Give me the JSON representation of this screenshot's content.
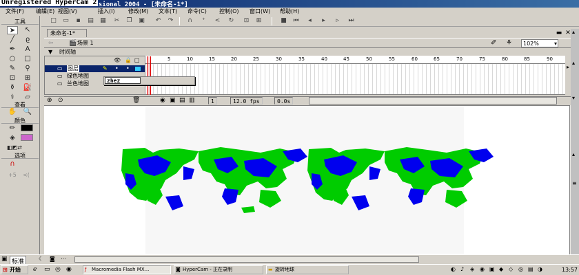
{
  "window": {
    "title": "Macromedia Flash MX Professional 2004 - [未命名-1*]",
    "recorder_watermark": "Unregistered HyperCam 2"
  },
  "menu": {
    "items": [
      "文件(F)",
      "编辑(E)",
      "视图(V)",
      "插入(I)",
      "修改(M)",
      "文本(T)",
      "命令(C)",
      "控制(O)",
      "窗口(W)",
      "帮助(H)"
    ]
  },
  "tools": {
    "heading": "工具",
    "view_heading": "查看",
    "colors_heading": "颜色",
    "options_heading": "选项"
  },
  "document": {
    "tab_label": "未命名-1*",
    "scene_label": "场景 1",
    "zoom_value": "102%",
    "timeline_heading": "时间轴"
  },
  "timeline": {
    "ruler_numbers": [
      "5",
      "10",
      "15",
      "20",
      "25",
      "30",
      "35",
      "40",
      "45",
      "50",
      "55",
      "60",
      "65",
      "70",
      "75",
      "80",
      "85",
      "90"
    ],
    "layers": [
      {
        "name": "图层",
        "active": true
      },
      {
        "name": "绿色地图",
        "active": false
      },
      {
        "name": "兰色地图",
        "active": false
      }
    ],
    "rename_input_value": "zhez",
    "current_frame": "1",
    "frame_rate": "12.0 fps",
    "elapsed_time": "0.0s"
  },
  "bottom_panel": {
    "label": "标准"
  },
  "taskbar": {
    "start_label": "开始",
    "tasks": [
      "Macromedia Flash MX...",
      "HyperCam - 正在录制",
      "旋转地球"
    ],
    "clock": "13:57"
  },
  "colors": {
    "map_green": "#00cc00",
    "map_blue": "#0000ee",
    "titlebar": "#0a246a",
    "playhead": "#dd0000"
  }
}
